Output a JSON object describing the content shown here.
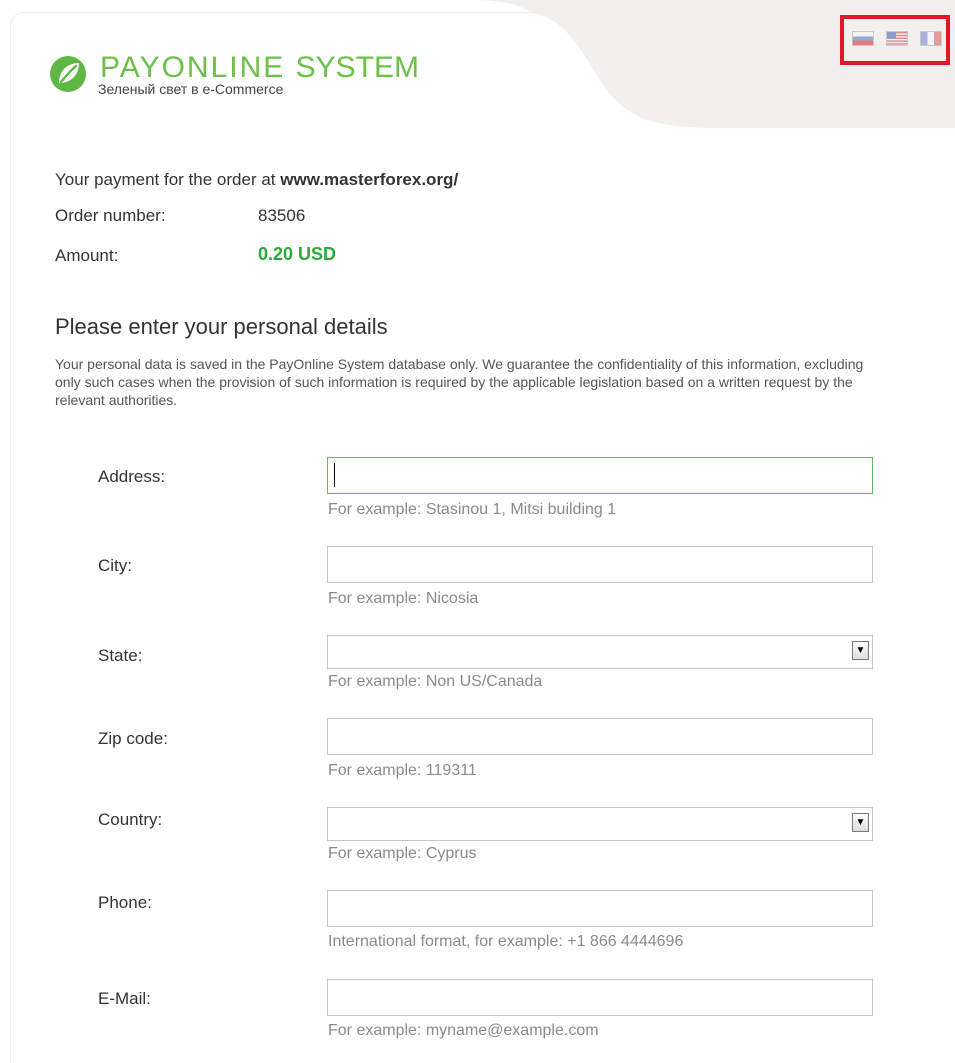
{
  "logo": {
    "brand": "PAYONLINE",
    "system": "SYSTEM",
    "tagline": "Зеленый свет в e-Commerce"
  },
  "languages": [
    "ru-flag-icon",
    "us-flag-icon",
    "fr-flag-icon"
  ],
  "order": {
    "payment_prefix": "Your payment for the order at",
    "merchant": "www.masterforex.org/",
    "order_label": "Order number:",
    "order_number": "83506",
    "amount_label": "Amount:",
    "amount": "0.20 USD"
  },
  "section": {
    "title": "Please enter your personal details",
    "note": "Your personal data is saved in the PayOnline System database only. We guarantee the confidentiality of this information, excluding only such cases when the provision of such information is required by the applicable legislation based on a written request by the relevant authorities."
  },
  "form": {
    "address": {
      "label": "Address:",
      "value": "",
      "hint": "For example: Stasinou 1, Mitsi building 1"
    },
    "city": {
      "label": "City:",
      "value": "",
      "hint": "For example: Nicosia"
    },
    "state": {
      "label": "State:",
      "selected": "",
      "hint": "For example: Non US/Canada"
    },
    "zip": {
      "label": "Zip code:",
      "value": "",
      "hint": "For example: 119311"
    },
    "country": {
      "label": "Country:",
      "selected": "",
      "hint": "For example: Cyprus"
    },
    "phone": {
      "label": "Phone:",
      "value": "",
      "hint": "International format, for example: +1 866 4444696"
    },
    "email": {
      "label": "E-Mail:",
      "value": "",
      "hint": "For example: myname@example.com"
    }
  },
  "colors": {
    "brand_green": "#6cc04a",
    "amount_green": "#2aaa3a",
    "highlight_red": "#e2162a",
    "active_border": "#5cbf5c"
  }
}
